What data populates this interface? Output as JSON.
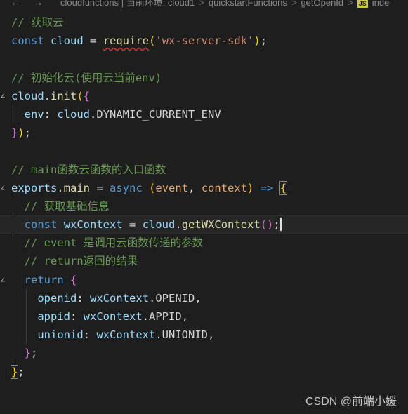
{
  "breadcrumb": {
    "items": [
      "cloudfunctions | 当前环境: cloud1",
      "quickstartFunctions",
      "getOpenId"
    ],
    "js_badge": "JS",
    "file": "inde"
  },
  "icons": [
    "back-arrow-icon",
    "forward-arrow-icon",
    "chevron-right-icon",
    "js-file-icon",
    "fold-chevron-icon"
  ],
  "code": {
    "l1": "// 获取云",
    "l2_kw": "const",
    "l2_var": "cloud",
    "l2_eq": " = ",
    "l2_fn": "require",
    "l2_open": "(",
    "l2_str": "'wx-server-sdk'",
    "l2_close": ")",
    "l2_semi": ";",
    "l4": "// 初始化云(使用云当前env)",
    "l5_var": "cloud",
    "l5_dot": ".",
    "l5_fn": "init",
    "l5_open1": "(",
    "l5_open2": "{",
    "l6_prop": "env",
    "l6_colon": ": ",
    "l6_var": "cloud",
    "l6_dot": ".",
    "l6_const": "DYNAMIC_CURRENT_ENV",
    "l7_close1": "}",
    "l7_close2": ")",
    "l7_semi": ";",
    "l9": "// main函数云函数的入口函数",
    "l10_var": "exports",
    "l10_dot": ".",
    "l10_fn": "main",
    "l10_eq": " = ",
    "l10_kw": "async",
    "l10_open": "(",
    "l10_p1": "event",
    "l10_comma": ", ",
    "l10_p2": "context",
    "l10_close": ")",
    "l10_arrow": " => ",
    "l10_brace": "{",
    "l11": "// 获取基础信息",
    "l12_kw": "const",
    "l12_var": "wxContext",
    "l12_eq": " = ",
    "l12_obj": "cloud",
    "l12_dot": ".",
    "l12_fn": "getWXContext",
    "l12_parens": "()",
    "l12_semi": ";",
    "l13": "// event 是调用云函数传递的参数",
    "l14": "// return返回的结果",
    "l15_kw": "return",
    "l15_brace": "{",
    "l16_prop": "openid",
    "l16_colon": ": ",
    "l16_var": "wxContext",
    "l16_dot": ".",
    "l16_const": "OPENID",
    "l16_comma": ",",
    "l17_prop": "appid",
    "l17_colon": ": ",
    "l17_var": "wxContext",
    "l17_dot": ".",
    "l17_const": "APPID",
    "l17_comma": ",",
    "l18_prop": "unionid",
    "l18_colon": ": ",
    "l18_var": "wxContext",
    "l18_dot": ".",
    "l18_const": "UNIONID",
    "l18_comma": ",",
    "l19_brace": "}",
    "l19_semi": ";",
    "l20_brace": "}",
    "l20_semi": ";"
  },
  "watermark": "CSDN @前端小媛"
}
